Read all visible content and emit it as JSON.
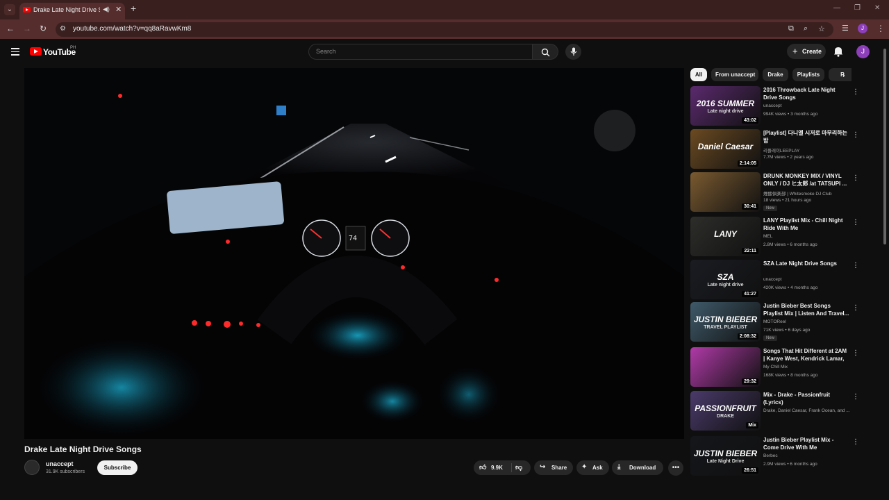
{
  "browser": {
    "tab_title": "Drake Late Night Drive Songs",
    "url": "youtube.com/watch?v=qq8aRavwKm8",
    "profile_initial": "J",
    "close_glyph": "✕",
    "newtab_glyph": "+"
  },
  "yt": {
    "logo_text": "YouTube",
    "region": "PH",
    "search_placeholder": "Search",
    "create_label": "Create",
    "avatar_initial": "J"
  },
  "video": {
    "title": "Drake Late Night Drive Songs",
    "channel": "unaccept",
    "subscribers": "31.9K subscribers",
    "subscribe_label": "Subscribe",
    "likes": "9.9K",
    "share_label": "Share",
    "ask_label": "Ask",
    "download_label": "Download",
    "speedometer_readout": "74"
  },
  "chips": [
    "All",
    "From unaccept",
    "Drake",
    "Playlists",
    "R"
  ],
  "recommendations": [
    {
      "title": "2016 Throwback Late Night Drive Songs",
      "channel": "unaccept",
      "meta": "994K views • 3 months ago",
      "duration": "43:02",
      "thumb_text": "2016 SUMMER",
      "thumb_sub": "Late night drive",
      "color": "#5b2a6e"
    },
    {
      "title": "[Playlist] 다니엘 시저로 마무리하는 밤",
      "channel": "리플레이LEEPLAY",
      "meta": "7.7M views • 2 years ago",
      "duration": "2:14:05",
      "thumb_text": "Daniel Caesar",
      "thumb_sub": "",
      "color": "#6b4a22"
    },
    {
      "title": "DRUNK MONKEY MIX / VINYL ONLY / DJ ヒ太郎 /at TATSUPI ...",
      "channel": "煙酸倶楽部 | Whitesmoke DJ Club",
      "meta": "18 views • 21 hours ago",
      "duration": "30:41",
      "new": "New",
      "thumb_text": "",
      "thumb_sub": "",
      "color": "#7a5a30"
    },
    {
      "title": "LANY Playlist Mix - Chill Night Ride With Me",
      "channel": "MEL",
      "meta": "2.8M views • 6 months ago",
      "duration": "22:11",
      "thumb_text": "LANY",
      "thumb_sub": "",
      "color": "#2d2d2a"
    },
    {
      "title": "SZA Late Night Drive Songs",
      "channel": "unaccept",
      "meta": "420K views • 4 months ago",
      "duration": "41:27",
      "thumb_text": "SZA",
      "thumb_sub": "Late night drive",
      "color": "#1a1c22"
    },
    {
      "title": "Justin Bieber Best Songs Playlist Mix | Listen And Travel...",
      "channel": "MOTOReel",
      "meta": "71K views • 6 days ago",
      "duration": "2:08:32",
      "new": "New",
      "thumb_text": "JUSTIN BIEBER",
      "thumb_sub": "TRAVEL PLAYLIST",
      "color": "#3f5a6a"
    },
    {
      "title": "Songs That Hit Different at 2AM | Kanye West, Kendrick Lamar, ...",
      "channel": "My Chill Mix",
      "meta": "168K views • 8 months ago",
      "duration": "29:32",
      "thumb_text": "",
      "thumb_sub": "",
      "color": "#b03aa8"
    },
    {
      "title": "Mix - Drake - Passionfruit (Lyrics)",
      "channel": "Drake, Daniel Caesar, Frank Ocean, and ...",
      "meta": "",
      "duration": "Mix",
      "thumb_text": "PASSIONFRUIT",
      "thumb_sub": "DRAKE",
      "color": "#4a3a6a"
    },
    {
      "title": "Justin Bieber Playlist Mix - Come Drive With Me",
      "channel": "Berbec",
      "meta": "2.9M views • 6 months ago",
      "duration": "26:51",
      "thumb_text": "JUSTIN BIEBER",
      "thumb_sub": "Late Night Drive",
      "color": "#14161a"
    }
  ],
  "colors": {
    "accent": "#ff0000",
    "chrome_dark": "#3a1f1f",
    "chrome_mid": "#552d2d",
    "avatar": "#8c3fb8"
  }
}
